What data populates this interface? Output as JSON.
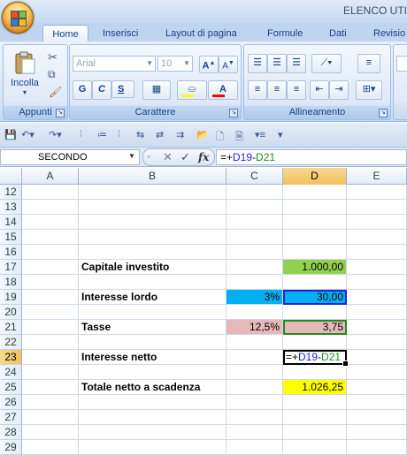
{
  "window": {
    "title": "ELENCO UTI"
  },
  "ribbon": {
    "tabs": [
      "Home",
      "Inserisci",
      "Layout di pagina",
      "Formule",
      "Dati",
      "Revisio"
    ],
    "clipboard": {
      "paste_label": "Incolla",
      "group_label": "Appunti"
    },
    "font": {
      "font_name": "Arial",
      "font_size": "10",
      "bold": "G",
      "italic": "C",
      "underline": "S",
      "group_label": "Carattere"
    },
    "alignment": {
      "group_label": "Allineamento"
    }
  },
  "formula_bar": {
    "name_box": "SECONDO",
    "fx": "fx",
    "formula": "=+D19-D21"
  },
  "grid": {
    "columns": [
      "A",
      "B",
      "C",
      "D",
      "E"
    ],
    "selected_column": "D",
    "rows": [
      {
        "n": "12"
      },
      {
        "n": "13"
      },
      {
        "n": "14"
      },
      {
        "n": "15"
      },
      {
        "n": "16"
      },
      {
        "n": "17",
        "b": "Capitale investito",
        "d": "1.000,00"
      },
      {
        "n": "18"
      },
      {
        "n": "19",
        "b": "Interesse lordo",
        "c": "3%",
        "d": "30,00"
      },
      {
        "n": "20"
      },
      {
        "n": "21",
        "b": "Tasse",
        "c": "12,5%",
        "d": "3,75"
      },
      {
        "n": "22"
      },
      {
        "n": "23",
        "b": "Interesse netto",
        "d": "=+D19-D21"
      },
      {
        "n": "24"
      },
      {
        "n": "25",
        "b": "Totale netto a scadenza",
        "d": "1.026,25"
      },
      {
        "n": "26"
      },
      {
        "n": "27"
      },
      {
        "n": "28"
      },
      {
        "n": "29"
      }
    ]
  },
  "colors": {
    "green_cell": "#92d050",
    "blue_cell": "#00b0f0",
    "pink_cell": "#e6b9b8",
    "yellow_cell": "#ffff00"
  }
}
